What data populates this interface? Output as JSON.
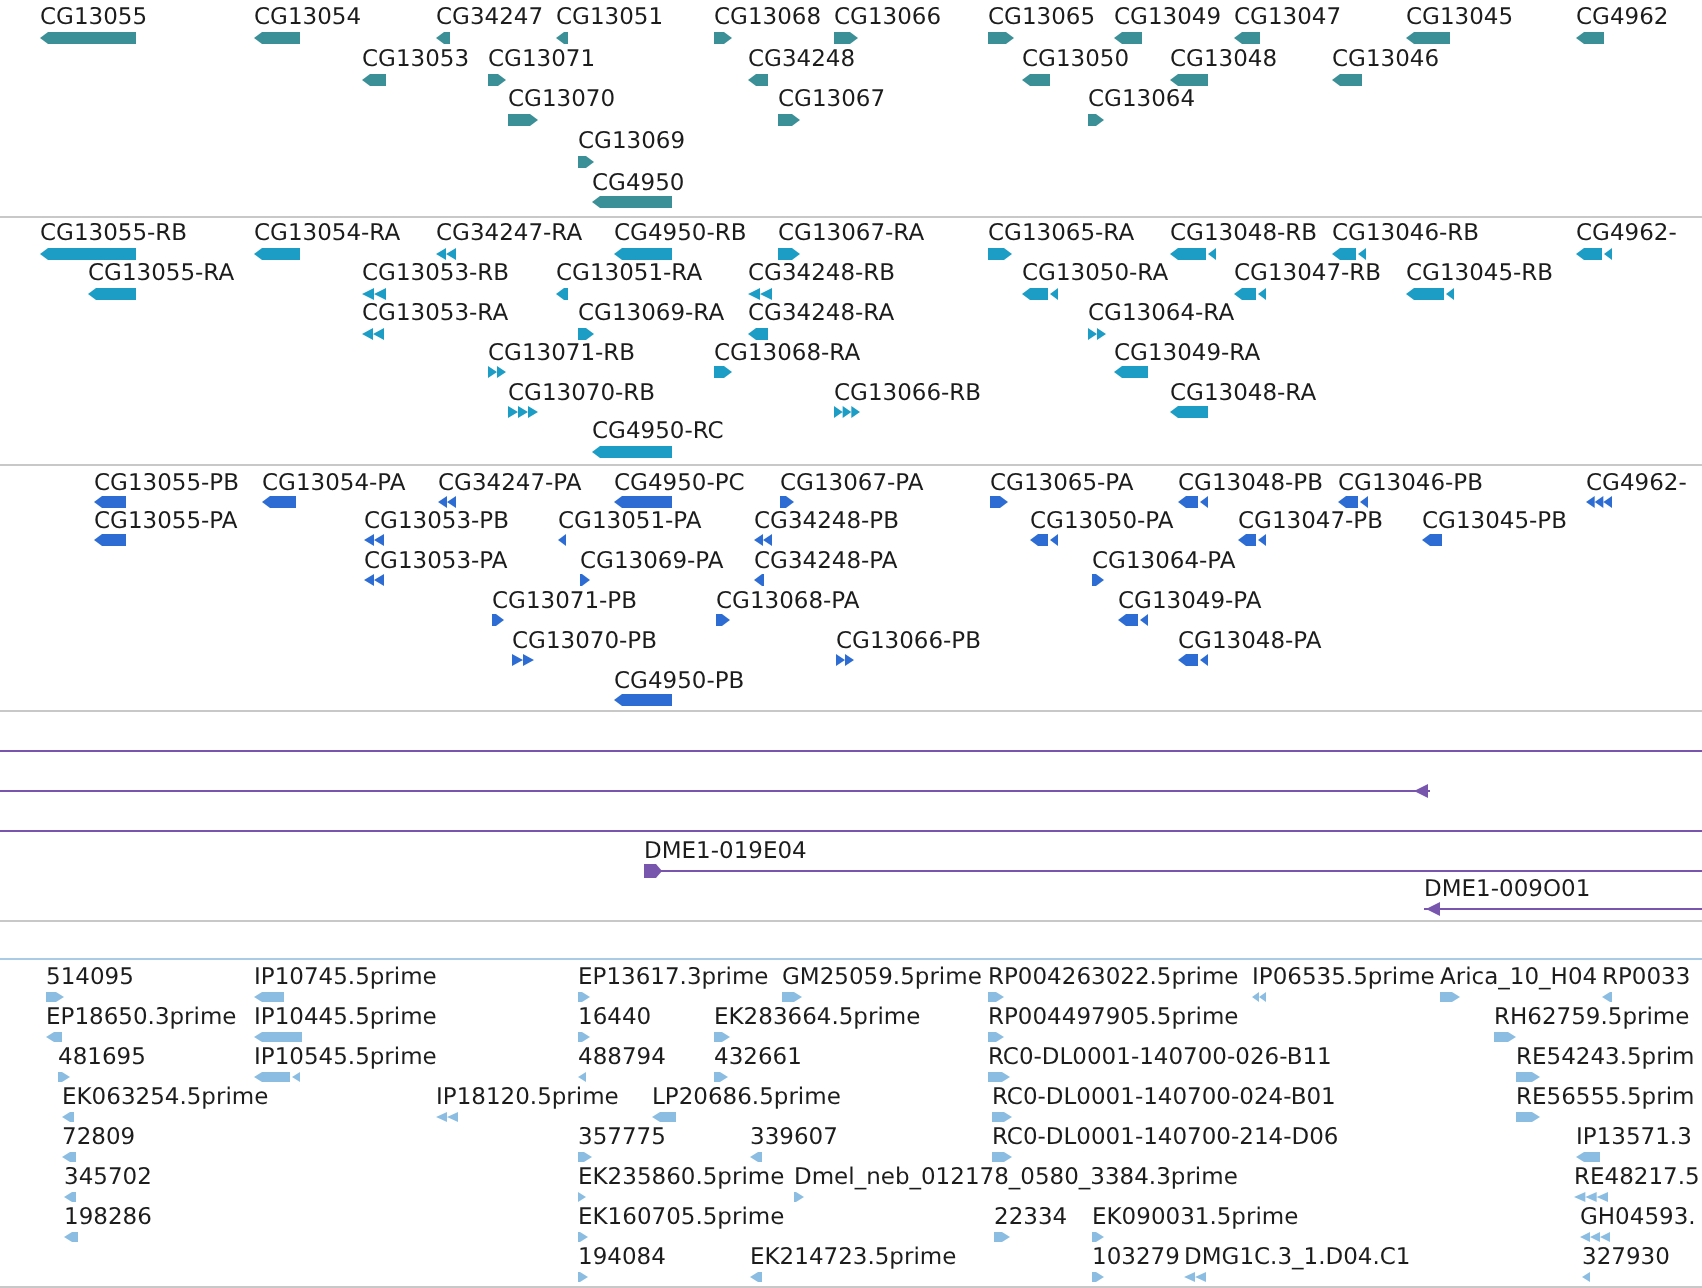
{
  "tracks": [
    {
      "kind": "gene",
      "features": [
        {
          "label": "CG13055",
          "reverse": true
        },
        {
          "label": "CG13054",
          "reverse": true
        },
        {
          "label": "CG34247",
          "reverse": true
        },
        {
          "label": "CG13051",
          "reverse": true
        },
        {
          "label": "CG13068",
          "reverse": false
        },
        {
          "label": "CG13066",
          "reverse": false
        },
        {
          "label": "CG13065",
          "reverse": false
        },
        {
          "label": "CG13049",
          "reverse": true
        },
        {
          "label": "CG13047",
          "reverse": true
        },
        {
          "label": "CG13045",
          "reverse": true
        },
        {
          "label": "CG4962",
          "reverse": true
        },
        {
          "label": "CG13053",
          "reverse": true
        },
        {
          "label": "CG13071",
          "reverse": false
        },
        {
          "label": "CG34248",
          "reverse": true
        },
        {
          "label": "CG13050",
          "reverse": true
        },
        {
          "label": "CG13048",
          "reverse": true
        },
        {
          "label": "CG13046",
          "reverse": true
        },
        {
          "label": "CG13070",
          "reverse": false
        },
        {
          "label": "CG13067",
          "reverse": false
        },
        {
          "label": "CG13064",
          "reverse": false
        },
        {
          "label": "CG13069",
          "reverse": false
        },
        {
          "label": "CG4950",
          "reverse": true
        }
      ]
    },
    {
      "kind": "transcript",
      "features": [
        {
          "label": "CG13055-RB",
          "reverse": true
        },
        {
          "label": "CG13054-RA",
          "reverse": true
        },
        {
          "label": "CG34247-RA",
          "reverse": true
        },
        {
          "label": "CG4950-RB",
          "reverse": true
        },
        {
          "label": "CG13067-RA",
          "reverse": false
        },
        {
          "label": "CG13065-RA",
          "reverse": false
        },
        {
          "label": "CG13048-RB",
          "reverse": true
        },
        {
          "label": "CG13046-RB",
          "reverse": true
        },
        {
          "label": "CG4962-",
          "reverse": true
        },
        {
          "label": "CG13055-RA",
          "reverse": true
        },
        {
          "label": "CG13053-RB",
          "reverse": true
        },
        {
          "label": "CG13051-RA",
          "reverse": true
        },
        {
          "label": "CG34248-RB",
          "reverse": true
        },
        {
          "label": "CG13050-RA",
          "reverse": true
        },
        {
          "label": "CG13047-RB",
          "reverse": true
        },
        {
          "label": "CG13045-RB",
          "reverse": true
        },
        {
          "label": "CG13053-RA",
          "reverse": true
        },
        {
          "label": "CG13069-RA",
          "reverse": false
        },
        {
          "label": "CG34248-RA",
          "reverse": true
        },
        {
          "label": "CG13064-RA",
          "reverse": false
        },
        {
          "label": "CG13071-RB",
          "reverse": false
        },
        {
          "label": "CG13068-RA",
          "reverse": false
        },
        {
          "label": "CG13049-RA",
          "reverse": true
        },
        {
          "label": "CG13070-RB",
          "reverse": false
        },
        {
          "label": "CG13066-RB",
          "reverse": false
        },
        {
          "label": "CG13048-RA",
          "reverse": true
        },
        {
          "label": "CG4950-RC",
          "reverse": true
        }
      ]
    },
    {
      "kind": "protein",
      "features": [
        {
          "label": "CG13055-PB",
          "reverse": true
        },
        {
          "label": "CG13054-PA",
          "reverse": true
        },
        {
          "label": "CG34247-PA",
          "reverse": true
        },
        {
          "label": "CG4950-PC",
          "reverse": true
        },
        {
          "label": "CG13067-PA",
          "reverse": false
        },
        {
          "label": "CG13065-PA",
          "reverse": false
        },
        {
          "label": "CG13048-PB",
          "reverse": true
        },
        {
          "label": "CG13046-PB",
          "reverse": true
        },
        {
          "label": "CG4962-",
          "reverse": true
        },
        {
          "label": "CG13055-PA",
          "reverse": true
        },
        {
          "label": "CG13053-PB",
          "reverse": true
        },
        {
          "label": "CG13051-PA",
          "reverse": true
        },
        {
          "label": "CG34248-PB",
          "reverse": true
        },
        {
          "label": "CG13050-PA",
          "reverse": true
        },
        {
          "label": "CG13047-PB",
          "reverse": true
        },
        {
          "label": "CG13045-PB",
          "reverse": true
        },
        {
          "label": "CG13053-PA",
          "reverse": true
        },
        {
          "label": "CG13069-PA",
          "reverse": false
        },
        {
          "label": "CG34248-PA",
          "reverse": true
        },
        {
          "label": "CG13064-PA",
          "reverse": false
        },
        {
          "label": "CG13071-PB",
          "reverse": false
        },
        {
          "label": "CG13068-PA",
          "reverse": false
        },
        {
          "label": "CG13049-PA",
          "reverse": true
        },
        {
          "label": "CG13070-PB",
          "reverse": false
        },
        {
          "label": "CG13066-PB",
          "reverse": false
        },
        {
          "label": "CG13048-PA",
          "reverse": true
        },
        {
          "label": "CG4950-PB",
          "reverse": true
        }
      ]
    },
    {
      "kind": "clone",
      "features": [
        {
          "end_marker": false
        },
        {
          "end_marker": true,
          "reverse": true
        },
        {
          "end_marker": false
        },
        {
          "label": "DME1-019E04",
          "end_marker": true,
          "reverse": false
        },
        {
          "label": "DME1-009O01",
          "end_marker": true,
          "reverse": true
        }
      ]
    },
    {
      "kind": "est",
      "features": [
        {
          "label": "514095",
          "reverse": false
        },
        {
          "label": "IP10745.5prime",
          "reverse": true
        },
        {
          "label": "EP13617.3prime",
          "reverse": false
        },
        {
          "label": "GM25059.5prime",
          "reverse": false
        },
        {
          "label": "RP004263022.5prime",
          "reverse": false
        },
        {
          "label": "IP06535.5prime",
          "reverse": true
        },
        {
          "label": "Arica_10_H04",
          "reverse": false
        },
        {
          "label": "RP0033",
          "reverse": true
        },
        {
          "label": "EP18650.3prime",
          "reverse": true
        },
        {
          "label": "IP10445.5prime",
          "reverse": true
        },
        {
          "label": "16440",
          "reverse": false
        },
        {
          "label": "EK283664.5prime",
          "reverse": false
        },
        {
          "label": "RP004497905.5prime",
          "reverse": false
        },
        {
          "label": "RH62759.5prime",
          "reverse": false
        },
        {
          "label": "481695",
          "reverse": false
        },
        {
          "label": "IP10545.5prime",
          "reverse": true
        },
        {
          "label": "488794",
          "reverse": true
        },
        {
          "label": "432661",
          "reverse": false
        },
        {
          "label": "RC0-DL0001-140700-026-B11",
          "reverse": false
        },
        {
          "label": "RE54243.5prim",
          "reverse": false
        },
        {
          "label": "EK063254.5prime",
          "reverse": true
        },
        {
          "label": "IP18120.5prime",
          "reverse": true
        },
        {
          "label": "LP20686.5prime",
          "reverse": true
        },
        {
          "label": "RC0-DL0001-140700-024-B01",
          "reverse": false
        },
        {
          "label": "RE56555.5prim",
          "reverse": false
        },
        {
          "label": "72809",
          "reverse": true
        },
        {
          "label": "357775",
          "reverse": false
        },
        {
          "label": "339607",
          "reverse": true
        },
        {
          "label": "RC0-DL0001-140700-214-D06",
          "reverse": false
        },
        {
          "label": "IP13571.3",
          "reverse": true
        },
        {
          "label": "345702",
          "reverse": true
        },
        {
          "label": "EK235860.5prime",
          "reverse": false
        },
        {
          "label": "Dmel_neb_012178_0580_3384.3prime",
          "reverse": false
        },
        {
          "label": "RE48217.5",
          "reverse": true
        },
        {
          "label": "198286",
          "reverse": true
        },
        {
          "label": "EK160705.5prime",
          "reverse": false
        },
        {
          "label": "22334",
          "reverse": false
        },
        {
          "label": "EK090031.5prime",
          "reverse": false
        },
        {
          "label": "GH04593.",
          "reverse": true
        },
        {
          "label": "194084",
          "reverse": false
        },
        {
          "label": "EK214723.5prime",
          "reverse": true
        },
        {
          "label": "103279",
          "reverse": false
        },
        {
          "label": "DMG1C.3_1.D04.C1",
          "reverse": true
        },
        {
          "label": "327930",
          "reverse": true
        }
      ]
    }
  ]
}
